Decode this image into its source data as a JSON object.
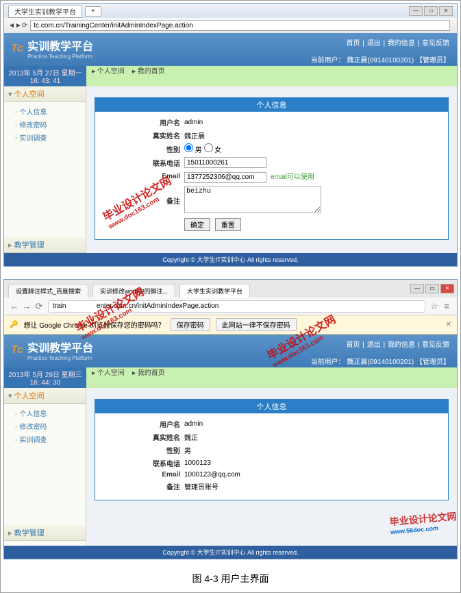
{
  "caption": "图 4-3 用户主界面",
  "watermark": {
    "main": "毕业设计论文网",
    "sub": "www.doc163.com"
  },
  "footer_logo": {
    "main": "毕业设计论文网",
    "sub": "www.56doc.com"
  },
  "s1": {
    "tab_title": "大学生实训教学平台",
    "address": "tc.com.cn/TrainingCenter/initAdminIndexPage.action",
    "logo_cn": "实训教学平台",
    "logo_en": "Practice Teaching Platform",
    "logo_tc": "Tc",
    "nav": {
      "home": "首页",
      "logout": "退出",
      "myinfo": "我的信息",
      "feedback": "意见反馈"
    },
    "user": {
      "label": "当前用户：",
      "name": "魏正晨(09140100201)",
      "role": "【管理员】"
    },
    "date_line1": "2013年 5月 27日 星期一",
    "date_line2": "16: 43: 41",
    "breadcrumb1": "▸ 个人空间",
    "breadcrumb2": "▸ 我的首页",
    "sidebar_head1": "个人空间",
    "sidebar_items": {
      "info": "个人信息",
      "pwd": "修改密码",
      "survey": "实训调查"
    },
    "sidebar_head2": "教学管理",
    "panel_title": "个人信息",
    "form": {
      "username_l": "用户名",
      "username_v": "admin",
      "realname_l": "真实姓名",
      "realname_v": "魏正晨",
      "sex_l": "性别",
      "male": "男",
      "female": "女",
      "phone_l": "联系电话",
      "phone_v": "15011000261",
      "email_l": "Email",
      "email_v": "1377252306@qq.com",
      "email_hint": "email可以使用",
      "remark_l": "备注",
      "remark_v": "beizhu",
      "submit": "确定",
      "reset": "重置"
    },
    "footer": "Copyright © 大学生IT实训中心 All rights reserved."
  },
  "s2": {
    "tab1": "设置脚注样式_百度搜索",
    "tab2": "实训修改word中的脚注...",
    "tab3": "大学生实训教学平台",
    "prompt_text": "想让 Google Chrome 浏览器保存您的密码吗？",
    "prompt_save": "保存密码",
    "prompt_never": "此网站一律不保存密码",
    "address": "train                enter.com.cn/initAdminIndexPage.action",
    "logo_cn": "实训教学平台",
    "logo_en": "Practice Teaching Platform",
    "logo_tc": "Tc",
    "nav": {
      "home": "首页",
      "logout": "退出",
      "myinfo": "我的信息",
      "feedback": "意见反馈"
    },
    "user": {
      "label": "当前用户：",
      "name": "魏正晨(09140100201)",
      "role": "【管理员】"
    },
    "date_line1": "2013年 5月 29日 星期三",
    "date_line2": "16: 44: 30",
    "breadcrumb1": "▸ 个人空间",
    "breadcrumb2": "▸ 我的首页",
    "sidebar_head1": "个人空间",
    "sidebar_items": {
      "info": "个人信息",
      "pwd": "修改密码",
      "survey": "实训调查"
    },
    "sidebar_head2": "教学管理",
    "panel_title": "个人信息",
    "form": {
      "username_l": "用户名",
      "username_v": "admin",
      "realname_l": "真实姓名",
      "realname_v": "魏正",
      "sex_l": "性别",
      "sex_v": "男",
      "phone_l": "联系电话",
      "phone_v": "1000123",
      "email_l": "Email",
      "email_v": "1000123@qq.com",
      "remark_l": "备注",
      "remark_v": "管理员账号"
    },
    "footer": "Copyright © 大学生IT实训中心 All rights reserved."
  }
}
